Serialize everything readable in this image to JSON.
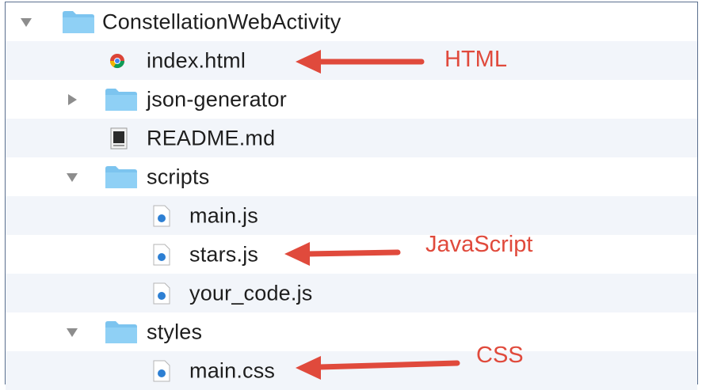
{
  "file_tree": {
    "items": [
      {
        "label": "ConstellationWebActivity",
        "icon": "folder-icon",
        "expanded": true
      },
      {
        "label": "index.html",
        "icon": "chrome-html-file-icon"
      },
      {
        "label": "json-generator",
        "icon": "folder-icon",
        "expanded": false
      },
      {
        "label": "README.md",
        "icon": "markdown-file-icon"
      },
      {
        "label": "scripts",
        "icon": "folder-icon",
        "expanded": true
      },
      {
        "label": "main.js",
        "icon": "js-file-icon"
      },
      {
        "label": "stars.js",
        "icon": "js-file-icon"
      },
      {
        "label": "your_code.js",
        "icon": "js-file-icon"
      },
      {
        "label": "styles",
        "icon": "folder-icon",
        "expanded": true
      },
      {
        "label": "main.css",
        "icon": "css-file-icon"
      }
    ]
  },
  "annotations": {
    "html": "HTML",
    "javascript": "JavaScript",
    "css": "CSS"
  },
  "colors": {
    "annotation": "#e04a3c",
    "folder": "#7cc4ef",
    "file_badge": "#2d7fd3",
    "border": "#5a6f8e"
  }
}
